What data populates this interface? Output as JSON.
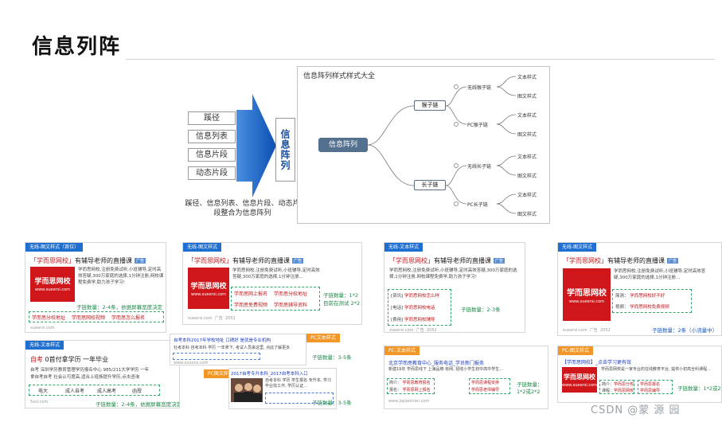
{
  "page": {
    "title": "信息列阵",
    "watermark": "CSDN @蒙 源 园",
    "page_indicator": ""
  },
  "flow": {
    "categories": [
      "蹊径",
      "信息列表",
      "信息片段",
      "动态片段"
    ],
    "vertical_label": "信息阵列",
    "merge_caption": "蹊径、信息列表、信息片段、动态片段整合为信息阵列"
  },
  "mindmap": {
    "title": "信息阵列样式样式大全",
    "root": "信息阵列",
    "branches": [
      {
        "label": "猴子链",
        "children": [
          {
            "label": "无线猴子链",
            "leaves": [
              "文本样式",
              "图文样式"
            ]
          },
          {
            "label": "PC猴子链",
            "leaves": [
              "文本样式",
              "图文样式"
            ]
          }
        ]
      },
      {
        "label": "长子链",
        "children": [
          {
            "label": "无线长子链",
            "leaves": [
              "文本样式",
              "图文样式"
            ]
          },
          {
            "label": "PC长子链",
            "leaves": [
              "文本样式",
              "图文样式"
            ]
          }
        ]
      }
    ]
  },
  "colors": {
    "brand_red": "#cf171b",
    "tag_blue": "#1f6fd1",
    "tag_orange": "#f29727",
    "note_green": "#1d8a4a"
  },
  "panels": {
    "p1": {
      "tag": "无线-图文样式（首位）",
      "title_q": "「学而思网校」",
      "title_rest": "有辅导老师的直播课",
      "badge": "广告",
      "logo": "学而思网校",
      "logo_url": "www.xueersi.com",
      "desc": "学而思网校,注册免费试听,小班辅导,定时高效答疑,300万家庭的选择,1分钟注册,网校课程免费学,助力孩子学习!",
      "links": [
        "学而思分校地址",
        "学而思网校视频",
        "学而思怎么报名"
      ],
      "note": "子链数量：2-4条，依据屏幕宽度决定",
      "foot": "xueersi.com"
    },
    "p2": {
      "tag": "无线-图文样式",
      "title_q": "「学而思网校」",
      "title_rest": "有辅导老师的直播课",
      "badge": "广告",
      "logo": "学而思网校",
      "logo_url": "www.xueersi.com",
      "desc": "学而思网校,注册免费试听,小班辅导,定时高效答疑,300万家庭的选择,1分钟注册...",
      "links": [
        "学而思网上报名",
        "学而思分校地址",
        "学而思免费视频",
        "学而思辅导资料"
      ],
      "note1": "子链数量：1*2",
      "note2": "目前在测试 2*2",
      "foot": "xueersi.com",
      "foot_ad": "广告",
      "foot_count": "2052"
    },
    "p3": {
      "tag": "无线-文本样式",
      "title_q": "「学而思网校」",
      "title_rest": "有辅导老师的直播课",
      "badge": "广告",
      "desc": "学而思网校,注册免费试听,小班辅导,定时高效答疑,300万家庭的选择,1分钟注册,网校课程免费学,助力孩子学习!",
      "rows": [
        {
          "key": "[资讯]",
          "val": "学而思网校怎么样"
        },
        {
          "key": "[电话]",
          "val": "学而思网校电话"
        },
        {
          "key": "[费用]",
          "val": "学而思网校辅导"
        }
      ],
      "note": "子链数量：2-3条",
      "foot": "xueersi.com",
      "foot_ad": "广告",
      "foot_count": "2052"
    },
    "p4": {
      "tag": "无线-图文样式",
      "title_q": "「学而思网校」",
      "title_rest": "有辅导老师的直播课",
      "badge": "广告",
      "logo": "学而思网校",
      "logo_url": "www.xueersi.com",
      "desc": "学而思网校,注册免费试听,小班辅导,定时高效答疑,300万家庭的选择,1分钟注册...",
      "rows": [
        {
          "key": "简测：",
          "val": "学而思网校好不好"
        },
        {
          "key": "视频：",
          "val": "学而思网校免费视频"
        }
      ],
      "note": "子链数量：2条（小流量中）",
      "foot": "xueersi.com",
      "foot_ad": "广告",
      "foot_count": "2052"
    },
    "p5": {
      "tag": "无线-文本样式",
      "title_accent": "自考",
      "title_rest": "0首付拿学历 一年毕业",
      "desc1": "自考 深圳学历教育管理学历报名中心 985/211大学学历 一年",
      "desc2": "拿自考自考 社会认可度高,适合上班族提升学历,点击咨询",
      "links": [
        "电大",
        "成人自考",
        "成人高考",
        "函授"
      ],
      "note": "子链数量：2-4条，依据屏幕宽度决定",
      "foot": "5xsi.com"
    },
    "p6": {
      "tag": "PC文本样式",
      "title": "自考本科2017年学校地址 口碑好 是就是专业机构",
      "line1": "社考本科 自考本科 学历 一年拿下, 考试人员来这里, 点此了解更多",
      "line2": "www.xxxxxx.com",
      "note": "子链数量：3-5条"
    },
    "p7": {
      "tag": "PC图文样式",
      "title": "2017自考专升本科_2017自考本科入口",
      "desc": "自考本科 学历 学生报名 专升本, 学习 毕业找工作, 学历认证...",
      "note": "子链数量：3-5条"
    },
    "p8": {
      "tag": "PC-文本样式",
      "title": "北京学而思教育中心_服务电话_学员新门报务",
      "desc": "新建19年  学而思线下  上海品牌  有网, 招收小学生初中高中学生...",
      "rows": [
        {
          "key": "简介：",
          "val1": "学而思教育报名",
          "val2": "学而思课程安排"
        },
        {
          "key": "报名：",
          "val1": "学而思网上报名",
          "val2": "学而思老师辅导"
        }
      ],
      "note1": "子链数量：",
      "note2": "1*2或2*2",
      "foot": "www.jiajiaonian.com"
    },
    "p9": {
      "tag": "PC-图文样式",
      "title": "【学而思网校】_点击学习更有效",
      "logo": "学而思网校",
      "logo_url": "www.xueersi.com",
      "desc": "学而思网校是一家专业的在线教育平台, 提供小初高全科课程...",
      "rows": [
        {
          "key": "简介：",
          "val1": "学而思分校",
          "val2": "学而思报名"
        },
        {
          "key": "课程：",
          "val1": "学而思网校",
          "val2": "学而思辅导"
        }
      ],
      "note": "子链数量：1*2或2*2"
    }
  }
}
